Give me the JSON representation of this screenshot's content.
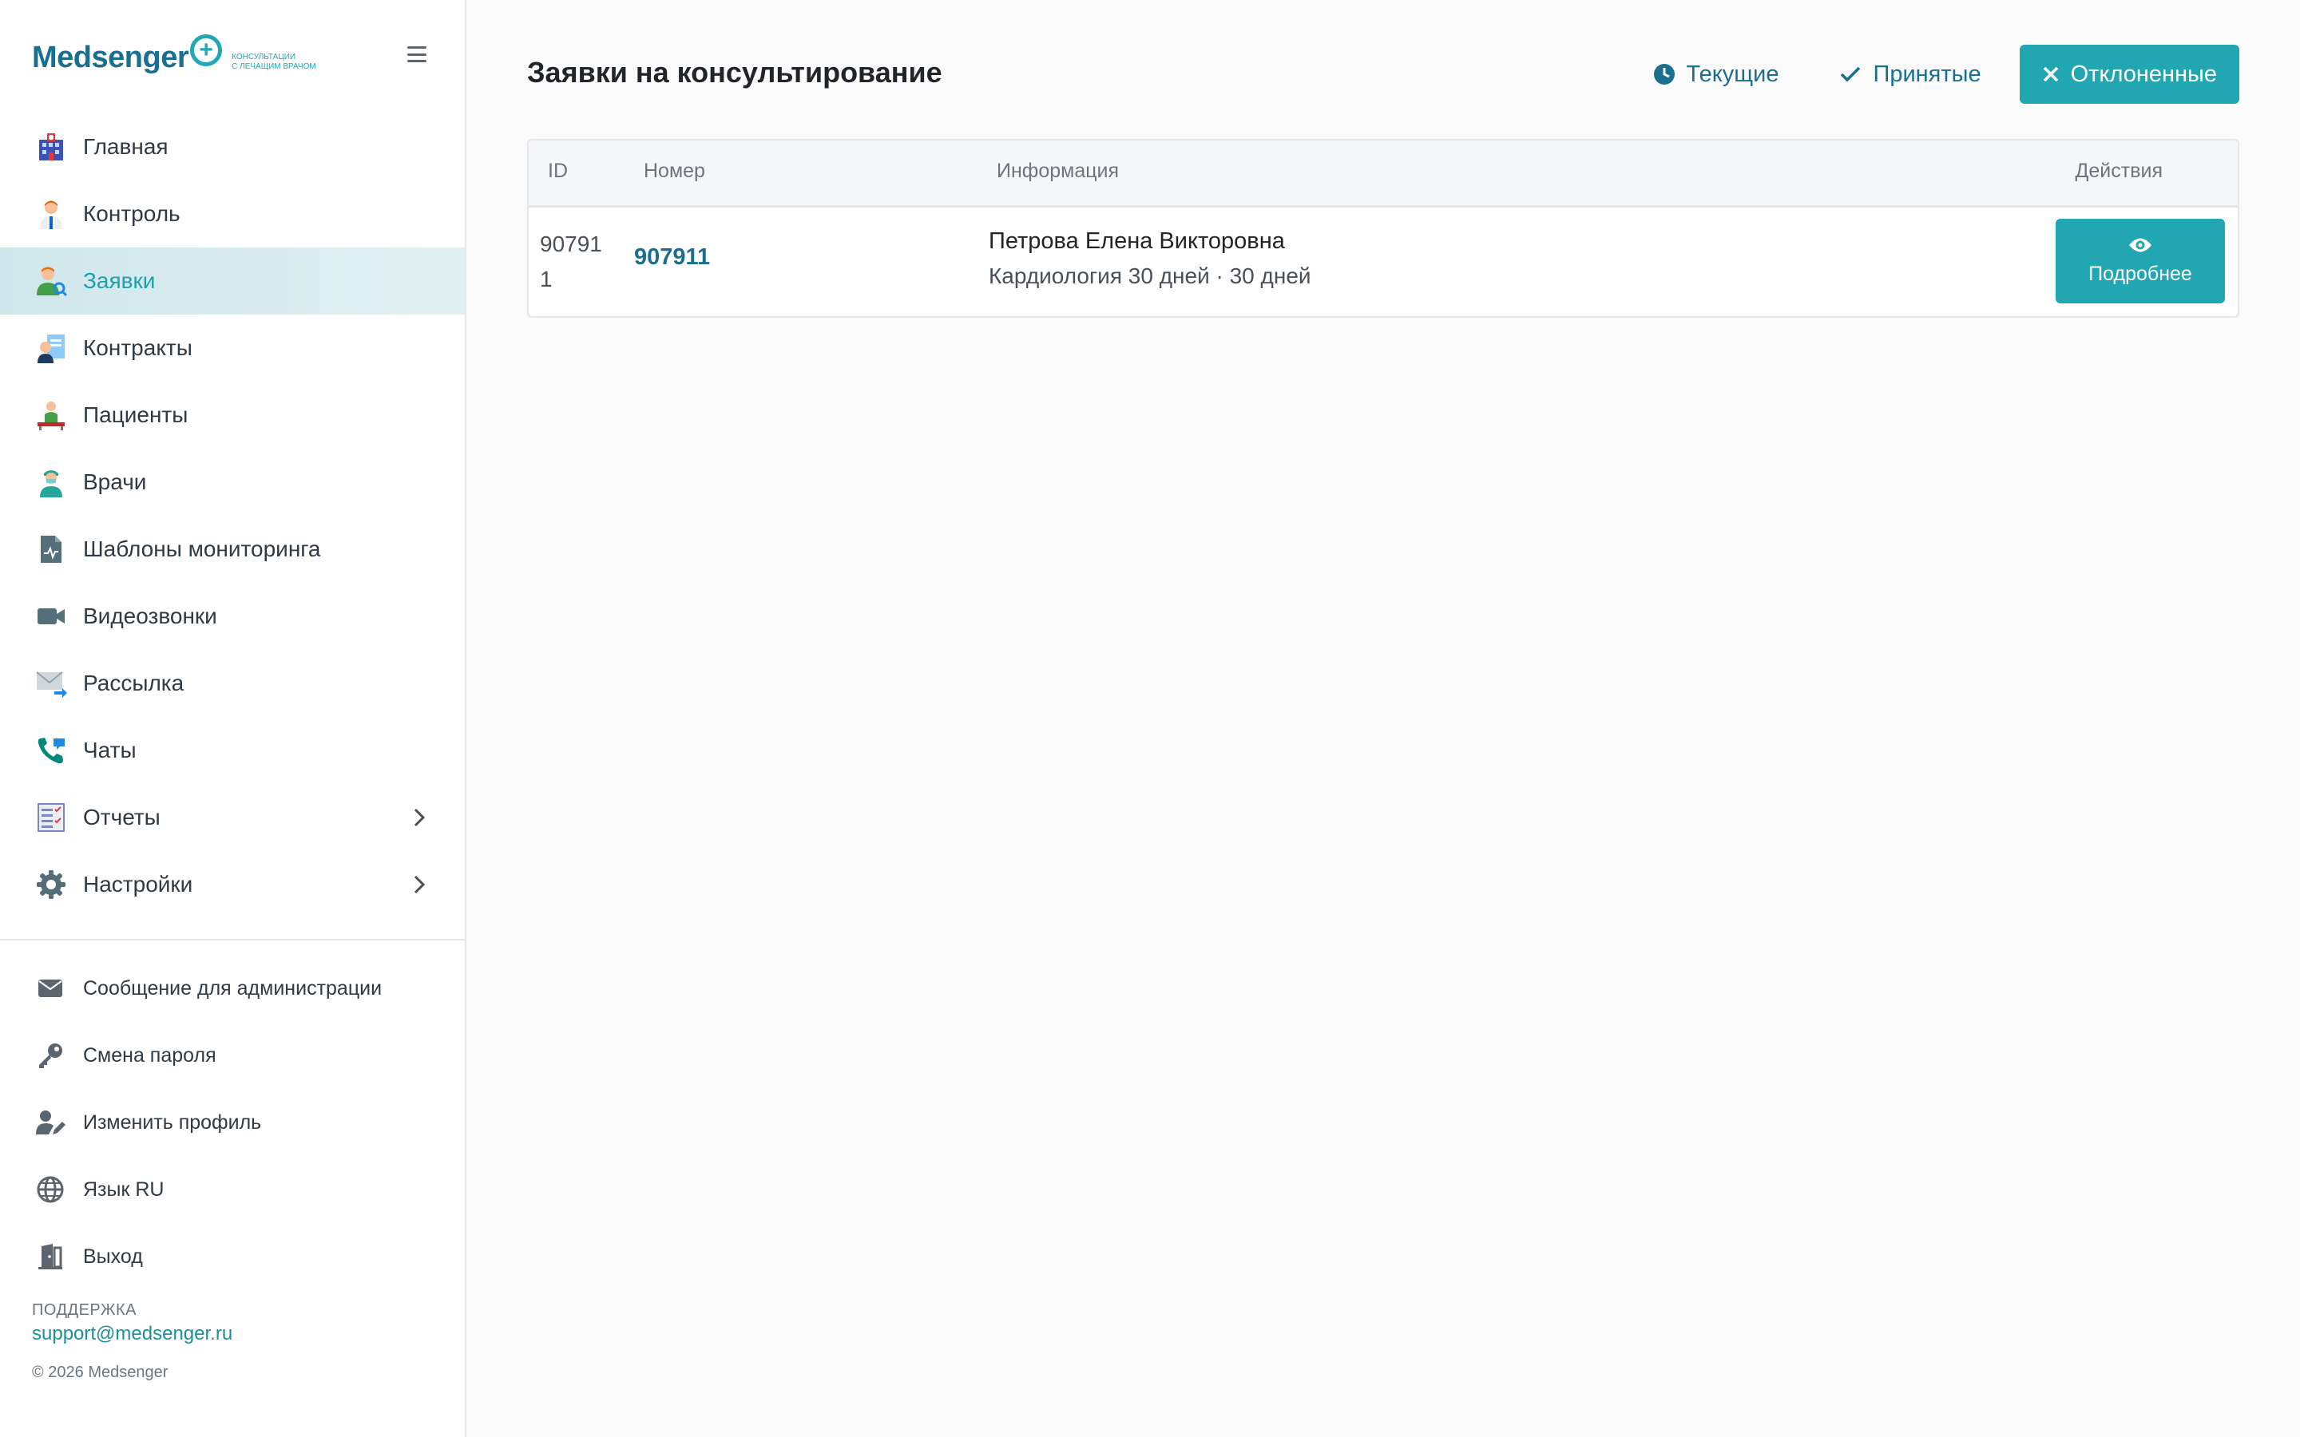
{
  "logo": {
    "word": "Medsenger",
    "tagline_1": "консультации",
    "tagline_2": "с лечащим врачом"
  },
  "sidebar": {
    "items": [
      {
        "label": "Главная",
        "icon": "hospital-icon"
      },
      {
        "label": "Контроль",
        "icon": "doctor-icon"
      },
      {
        "label": "Заявки",
        "icon": "user-search-icon",
        "active": true
      },
      {
        "label": "Контракты",
        "icon": "contract-icon"
      },
      {
        "label": "Пациенты",
        "icon": "patient-icon"
      },
      {
        "label": "Врачи",
        "icon": "physician-icon"
      },
      {
        "label": "Шаблоны мониторинга",
        "icon": "template-icon"
      },
      {
        "label": "Видеозвонки",
        "icon": "video-icon"
      },
      {
        "label": "Рассылка",
        "icon": "mail-send-icon"
      },
      {
        "label": "Чаты",
        "icon": "phone-chat-icon"
      },
      {
        "label": "Отчеты",
        "icon": "report-icon",
        "expandable": true
      },
      {
        "label": "Настройки",
        "icon": "gear-icon",
        "expandable": true
      }
    ],
    "bottom": [
      {
        "label": "Сообщение для администрации",
        "icon": "envelope-icon"
      },
      {
        "label": "Смена пароля",
        "icon": "key-icon"
      },
      {
        "label": "Изменить профиль",
        "icon": "user-edit-icon"
      },
      {
        "label": "Язык RU",
        "icon": "globe-icon"
      },
      {
        "label": "Выход",
        "icon": "door-exit-icon"
      }
    ],
    "support_title": "ПОДДЕРЖКА",
    "support_email": "support@medsenger.ru",
    "copyright": "© 2026 Medsenger"
  },
  "main": {
    "title": "Заявки на консультирование",
    "filters": [
      {
        "label": "Текущие",
        "icon": "clock-icon",
        "active": false
      },
      {
        "label": "Принятые",
        "icon": "check-icon",
        "active": false
      },
      {
        "label": "Отклоненные",
        "icon": "close-icon",
        "active": true
      }
    ],
    "table": {
      "headers": {
        "id": "ID",
        "number": "Номер",
        "info": "Информация",
        "actions": "Действия"
      },
      "rows": [
        {
          "id": "907911",
          "number": "907911",
          "name": "Петрова Елена Викторовна",
          "details": "Кардиология 30 дней · 30 дней",
          "action_label": "Подробнее"
        }
      ]
    }
  },
  "colors": {
    "accent": "#22a7b2",
    "brand": "#1a6e8e",
    "active_bg": "#d6ebef"
  }
}
